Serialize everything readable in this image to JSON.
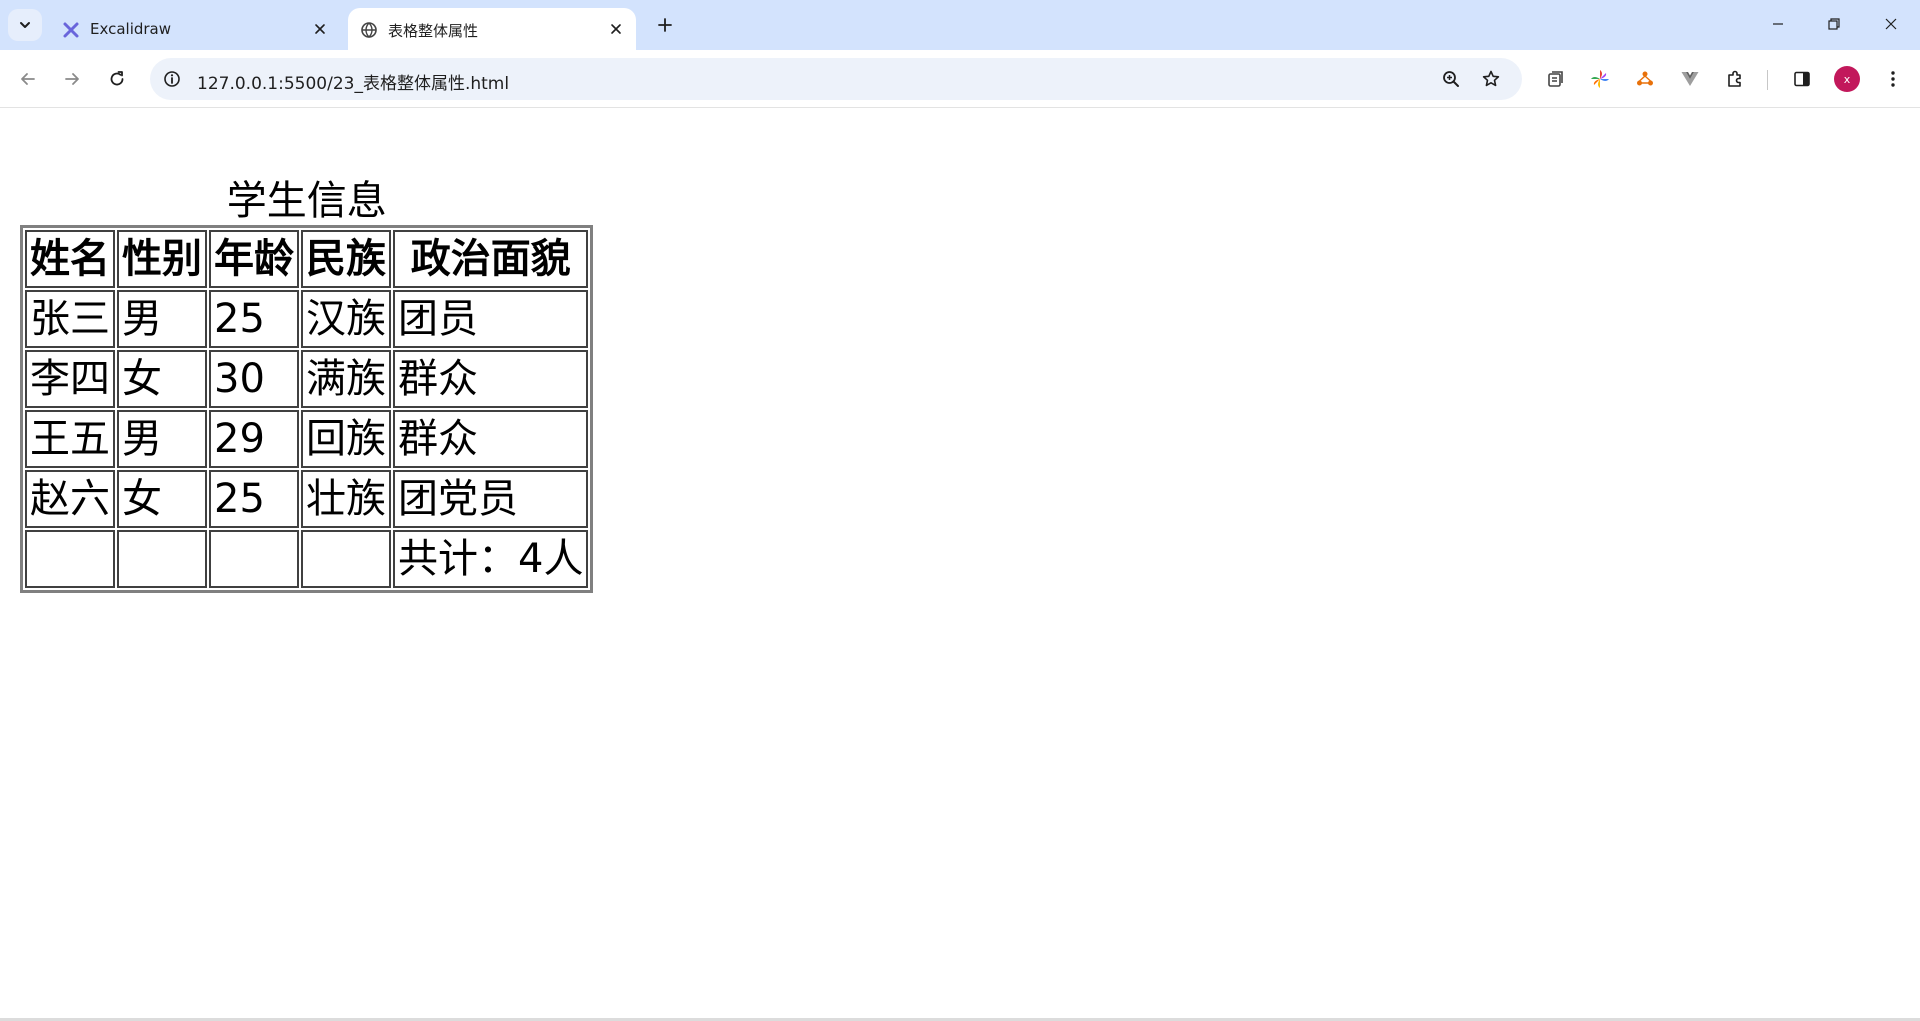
{
  "browser": {
    "tabs": [
      {
        "title": "Excalidraw",
        "favicon": "excalidraw-icon",
        "active": false
      },
      {
        "title": "表格整体属性",
        "favicon": "globe-icon",
        "active": true
      }
    ],
    "url": "127.0.0.1:5500/23_表格整体属性.html",
    "profile_initial": "x",
    "accent_color": "#d3e3fd",
    "avatar_color": "#c2185b"
  },
  "table": {
    "caption": "学生信息",
    "headers": [
      "姓名",
      "性别",
      "年龄",
      "民族",
      "政治面貌"
    ],
    "rows": [
      [
        "张三",
        "男",
        "25",
        "汉族",
        "团员"
      ],
      [
        "李四",
        "女",
        "30",
        "满族",
        "群众"
      ],
      [
        "王五",
        "男",
        "29",
        "回族",
        "群众"
      ],
      [
        "赵六",
        "女",
        "25",
        "壮族",
        "团党员"
      ]
    ],
    "footer": [
      "",
      "",
      "",
      "",
      "共计：4人"
    ]
  }
}
